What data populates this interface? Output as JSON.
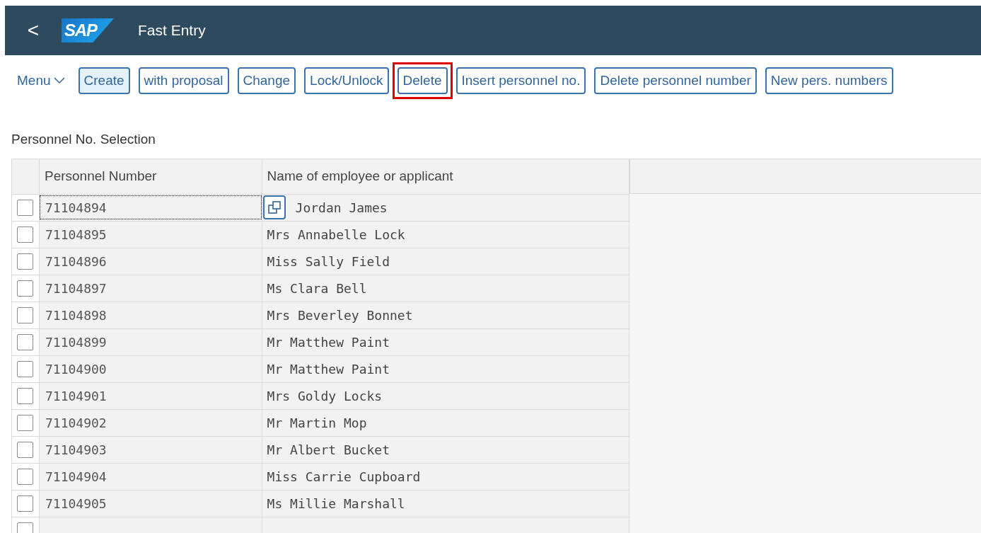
{
  "header": {
    "back": "<",
    "logo": "SAP",
    "title": "Fast Entry"
  },
  "toolbar": {
    "menu": "Menu",
    "buttons": [
      {
        "label": "Create",
        "selected": true,
        "highlighted": false
      },
      {
        "label": "with proposal",
        "selected": false,
        "highlighted": false
      },
      {
        "label": "Change",
        "selected": false,
        "highlighted": false
      },
      {
        "label": "Lock/Unlock",
        "selected": false,
        "highlighted": false
      },
      {
        "label": "Delete",
        "selected": false,
        "highlighted": true
      },
      {
        "label": "Insert personnel no.",
        "selected": false,
        "highlighted": false
      },
      {
        "label": "Delete personnel number",
        "selected": false,
        "highlighted": false
      },
      {
        "label": "New pers. numbers",
        "selected": false,
        "highlighted": false
      }
    ]
  },
  "section_title": "Personnel No. Selection",
  "table": {
    "columns": [
      "Personnel Number",
      "Name of employee or applicant"
    ],
    "rows": [
      {
        "number": "71104894",
        "name": "Jordan James",
        "checked": false,
        "focused": true
      },
      {
        "number": "71104895",
        "name": "Mrs Annabelle Lock",
        "checked": false,
        "focused": false
      },
      {
        "number": "71104896",
        "name": "Miss Sally Field",
        "checked": false,
        "focused": false
      },
      {
        "number": "71104897",
        "name": "Ms Clara Bell",
        "checked": false,
        "focused": false
      },
      {
        "number": "71104898",
        "name": "Mrs Beverley Bonnet",
        "checked": false,
        "focused": false
      },
      {
        "number": "71104899",
        "name": "Mr Matthew Paint",
        "checked": false,
        "focused": false
      },
      {
        "number": "71104900",
        "name": "Mr Matthew Paint",
        "checked": false,
        "focused": false
      },
      {
        "number": "71104901",
        "name": "Mrs Goldy Locks",
        "checked": false,
        "focused": false
      },
      {
        "number": "71104902",
        "name": "Mr Martin Mop",
        "checked": false,
        "focused": false
      },
      {
        "number": "71104903",
        "name": "Mr Albert Bucket",
        "checked": false,
        "focused": false
      },
      {
        "number": "71104904",
        "name": "Miss Carrie Cupboard",
        "checked": false,
        "focused": false
      },
      {
        "number": "71104905",
        "name": "Ms Millie Marshall",
        "checked": false,
        "focused": false
      }
    ],
    "blank_row": {
      "checked": false
    }
  }
}
